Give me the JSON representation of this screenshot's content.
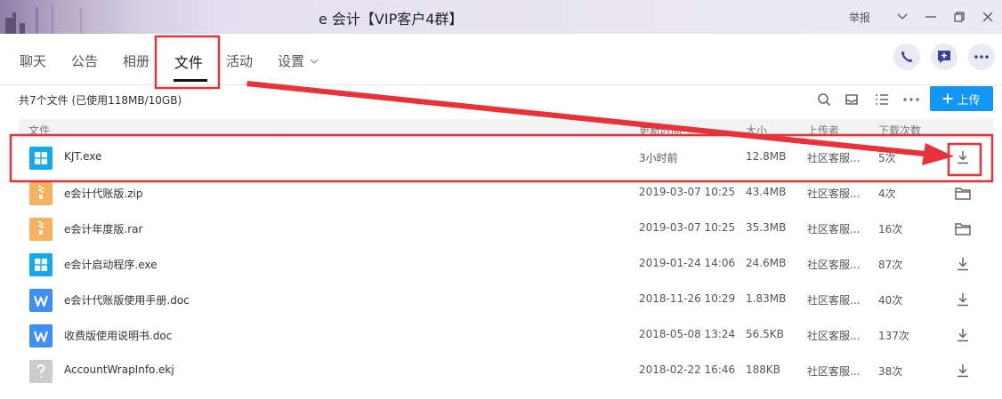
{
  "window": {
    "title": "e 会计【VIP客户4群】",
    "report_label": "举报"
  },
  "tabs": [
    {
      "label": "聊天"
    },
    {
      "label": "公告"
    },
    {
      "label": "相册"
    },
    {
      "label": "文件",
      "active": true
    },
    {
      "label": "活动"
    },
    {
      "label": "设置"
    }
  ],
  "actions": {
    "call_icon": "phone-icon",
    "message_icon": "message-plus-icon",
    "more_icon": "more-dots-icon"
  },
  "files": {
    "summary": "共7个文件 (已使用118MB/10GB)",
    "upload_label": "上传",
    "columns": {
      "name": "文件",
      "time": "更新时间",
      "size": "大小",
      "uploader": "上传者",
      "downloads": "下载次数"
    },
    "rows": [
      {
        "name": "KJT.exe",
        "time": "3小时前",
        "size": "12.8MB",
        "uploader": "社区客服...",
        "downloads": "5次",
        "type": "exe",
        "action": "download-icon"
      },
      {
        "name": "e会计代账版.zip",
        "time": "2019-03-07 10:25",
        "size": "43.4MB",
        "uploader": "社区客服...",
        "downloads": "4次",
        "type": "zip",
        "action": "folder-icon"
      },
      {
        "name": "e会计年度版.rar",
        "time": "2019-03-07 10:25",
        "size": "35.3MB",
        "uploader": "社区客服...",
        "downloads": "16次",
        "type": "zip",
        "action": "folder-icon"
      },
      {
        "name": "e会计启动程序.exe",
        "time": "2019-01-24 14:06",
        "size": "24.6MB",
        "uploader": "社区客服...",
        "downloads": "87次",
        "type": "exe",
        "action": "download-icon"
      },
      {
        "name": "e会计代账版使用手册.doc",
        "time": "2018-11-26 10:29",
        "size": "1.83MB",
        "uploader": "社区客服...",
        "downloads": "40次",
        "type": "doc",
        "action": "download-icon"
      },
      {
        "name": "收费版使用说明书.doc",
        "time": "2018-05-08 13:24",
        "size": "56.5KB",
        "uploader": "社区客服...",
        "downloads": "137次",
        "type": "doc",
        "action": "download-icon"
      },
      {
        "name": "AccountWrapInfo.ekj",
        "time": "2018-02-22 16:46",
        "size": "188KB",
        "uploader": "社区客服...",
        "downloads": "38次",
        "type": "unknown",
        "action": "download-icon"
      }
    ]
  },
  "colors": {
    "accent": "#1296f5",
    "exe": "#11a9f0",
    "zip": "#f8b160",
    "doc": "#3d8ef5",
    "unknown": "#cccccc",
    "annotation": "#e8323a"
  }
}
